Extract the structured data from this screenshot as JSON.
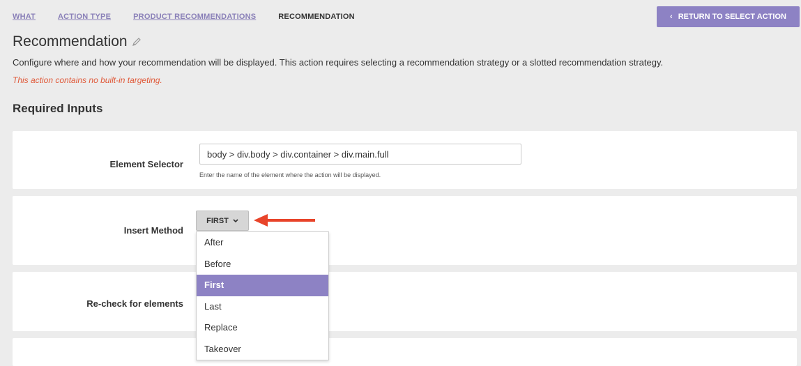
{
  "breadcrumb": {
    "items": [
      "WHAT",
      "ACTION TYPE",
      "PRODUCT RECOMMENDATIONS"
    ],
    "current": "RECOMMENDATION"
  },
  "return_button": {
    "label": "RETURN TO SELECT ACTION",
    "icon": "chevron-left-icon"
  },
  "page": {
    "title": "Recommendation",
    "description": "Configure where and how your recommendation will be displayed. This action requires selecting a recommendation strategy or a slotted recommendation strategy.",
    "warning": "This action contains no built-in targeting.",
    "section_title": "Required Inputs"
  },
  "element_selector": {
    "label": "Element Selector",
    "value": "body > div.body > div.container > div.main.full",
    "hint": "Enter the name of the element where the action will be displayed."
  },
  "insert_method": {
    "label": "Insert Method",
    "selected": "FIRST",
    "options": [
      "After",
      "Before",
      "First",
      "Last",
      "Replace",
      "Takeover"
    ],
    "highlighted": "First"
  },
  "recheck": {
    "label": "Re-check for elements"
  },
  "colors": {
    "accent": "#8d82c4",
    "warning": "#e05a3a",
    "arrow": "#e8442a"
  }
}
